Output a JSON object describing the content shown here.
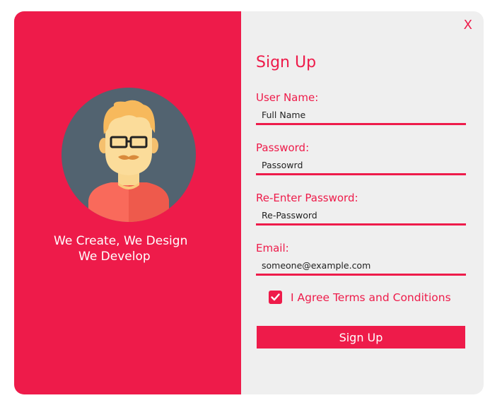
{
  "left_panel": {
    "tagline_line1": "We Create, We Design",
    "tagline_line2": "We Develop",
    "avatar_icon": "developer-avatar-icon"
  },
  "form": {
    "title": "Sign Up",
    "close_label": "X",
    "fields": [
      {
        "label": "User Name:",
        "value": "Full Name"
      },
      {
        "label": "Password:",
        "value": "Passowrd"
      },
      {
        "label": "Re-Enter Password:",
        "value": "Re-Password"
      },
      {
        "label": "Email:",
        "value": "someone@example.com"
      }
    ],
    "agree_label": "I Agree Terms and Conditions",
    "agree_checked": true,
    "submit_label": "Sign Up"
  },
  "colors": {
    "accent": "#ee1b4a",
    "panel_bg": "#efefef",
    "avatar_bg": "#526370"
  }
}
